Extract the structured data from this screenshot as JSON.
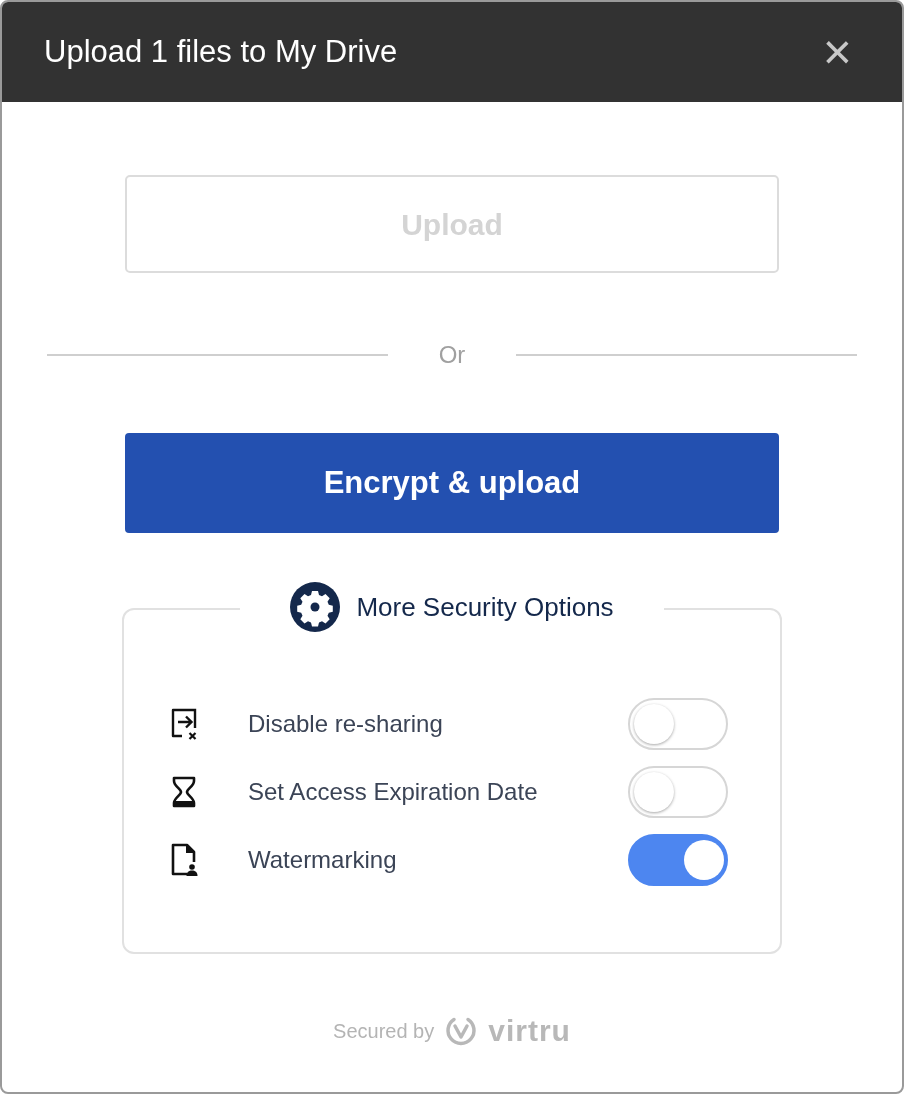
{
  "window": {
    "title": "Upload 1 files to My Drive",
    "close": "×"
  },
  "upload_button": {
    "label": "Upload",
    "disabled": true
  },
  "divider_text": "Or",
  "encrypt_button": {
    "label": "Encrypt & upload"
  },
  "security_options": {
    "title": "More Security Options",
    "options": [
      {
        "kind": "reshare",
        "label": "Disable re-sharing",
        "on": false
      },
      {
        "kind": "expiry",
        "label": "Set Access Expiration Date",
        "on": false
      },
      {
        "kind": "watermark",
        "label": "Watermarking",
        "on": true
      }
    ]
  },
  "footer": {
    "text": "Secured by",
    "brand": "virtru"
  }
}
